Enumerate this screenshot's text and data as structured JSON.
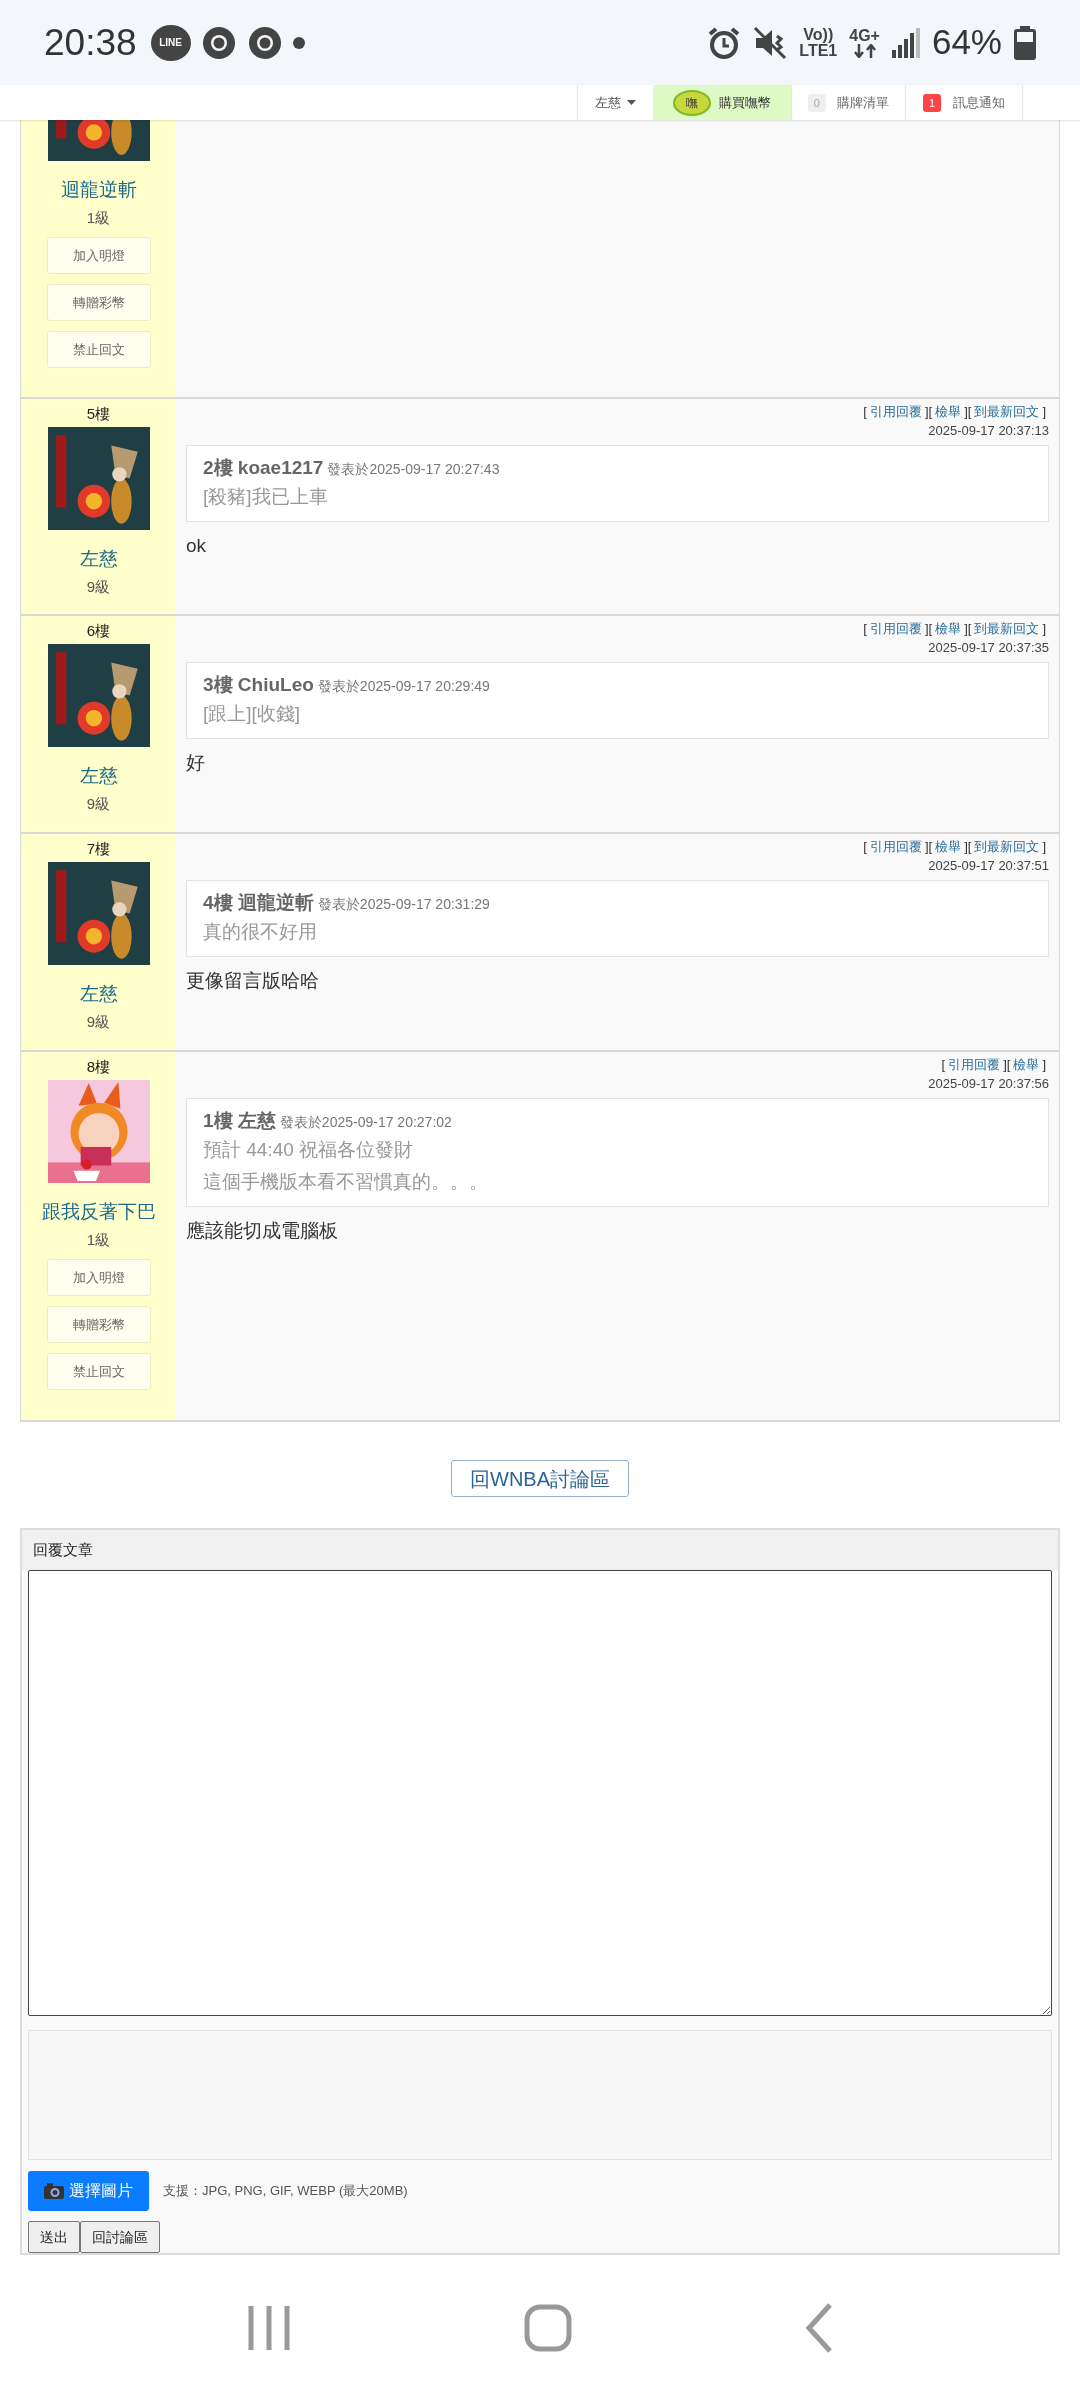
{
  "status_bar": {
    "time": "20:38",
    "notifications": [
      {
        "kind": "line",
        "label": "LINE"
      },
      {
        "kind": "chrome"
      },
      {
        "kind": "chrome"
      },
      {
        "kind": "dot"
      }
    ],
    "volte": "Vo))",
    "lte": "LTE1",
    "network": "4G+",
    "battery": "64%"
  },
  "top_nav": {
    "user": "左慈",
    "coins": {
      "icon_text": "嘸",
      "label": "購買嘸幣"
    },
    "cart": {
      "count": "0",
      "label": "購牌清單"
    },
    "messages": {
      "count": "1",
      "label": "訊息通知"
    }
  },
  "posts": [
    {
      "author": "迴龍逆斬",
      "level": "1級",
      "actions": [
        "加入明燈",
        "轉贈彩幣",
        "禁止回文"
      ]
    },
    {
      "floor": "5樓",
      "author": "左慈",
      "level": "9級",
      "links": [
        {
          "kind": "bracket",
          "text": "["
        },
        {
          "kind": "link",
          "text": "引用回覆"
        },
        {
          "kind": "bracket",
          "text": "]["
        },
        {
          "kind": "link",
          "text": "檢舉"
        },
        {
          "kind": "bracket",
          "text": "]["
        },
        {
          "kind": "link",
          "text": "到最新回文"
        },
        {
          "kind": "bracket",
          "text": "]"
        }
      ],
      "time": "2025-09-17 20:37:13",
      "quote": {
        "title": "2樓 koae1217",
        "posted": "發表於2025-09-17 20:27:43",
        "lines": [
          "[殺豬]我已上車"
        ]
      },
      "body": "ok"
    },
    {
      "floor": "6樓",
      "author": "左慈",
      "level": "9級",
      "links": [
        {
          "kind": "bracket",
          "text": "["
        },
        {
          "kind": "link",
          "text": "引用回覆"
        },
        {
          "kind": "bracket",
          "text": "]["
        },
        {
          "kind": "link",
          "text": "檢舉"
        },
        {
          "kind": "bracket",
          "text": "]["
        },
        {
          "kind": "link",
          "text": "到最新回文"
        },
        {
          "kind": "bracket",
          "text": "]"
        }
      ],
      "time": "2025-09-17 20:37:35",
      "quote": {
        "title": "3樓 ChiuLeo",
        "posted": "發表於2025-09-17 20:29:49",
        "lines": [
          "[跟上][收錢]"
        ]
      },
      "body": "好"
    },
    {
      "floor": "7樓",
      "author": "左慈",
      "level": "9級",
      "links": [
        {
          "kind": "bracket",
          "text": "["
        },
        {
          "kind": "link",
          "text": "引用回覆"
        },
        {
          "kind": "bracket",
          "text": "]["
        },
        {
          "kind": "link",
          "text": "檢舉"
        },
        {
          "kind": "bracket",
          "text": "]["
        },
        {
          "kind": "link",
          "text": "到最新回文"
        },
        {
          "kind": "bracket",
          "text": "]"
        }
      ],
      "time": "2025-09-17 20:37:51",
      "quote": {
        "title": "4樓 迴龍逆斬",
        "posted": "發表於2025-09-17 20:31:29",
        "lines": [
          "真的很不好用"
        ]
      },
      "body": "更像留言版哈哈"
    },
    {
      "floor": "8樓",
      "author": "跟我反著下巴",
      "level": "1級",
      "actions": [
        "加入明燈",
        "轉贈彩幣",
        "禁止回文"
      ],
      "links": [
        {
          "kind": "bracket",
          "text": "["
        },
        {
          "kind": "link",
          "text": "引用回覆"
        },
        {
          "kind": "bracket",
          "text": "]["
        },
        {
          "kind": "link",
          "text": "檢舉"
        },
        {
          "kind": "bracket",
          "text": "]"
        }
      ],
      "time": "2025-09-17 20:37:56",
      "quote": {
        "title": "1樓 左慈",
        "posted": "發表於2025-09-17 20:27:02",
        "lines": [
          "預計 44:40 祝福各位發財",
          "這個手機版本看不習慣真的。。。"
        ]
      },
      "body": "應該能切成電腦板"
    }
  ],
  "back_button": "回WNBA討論區",
  "reply_form": {
    "title": "回覆文章",
    "image_button": "選擇圖片",
    "hint": "支援：JPG, PNG, GIF, WEBP (最大20MB)",
    "buttons": [
      "送出",
      "回討論區"
    ]
  }
}
